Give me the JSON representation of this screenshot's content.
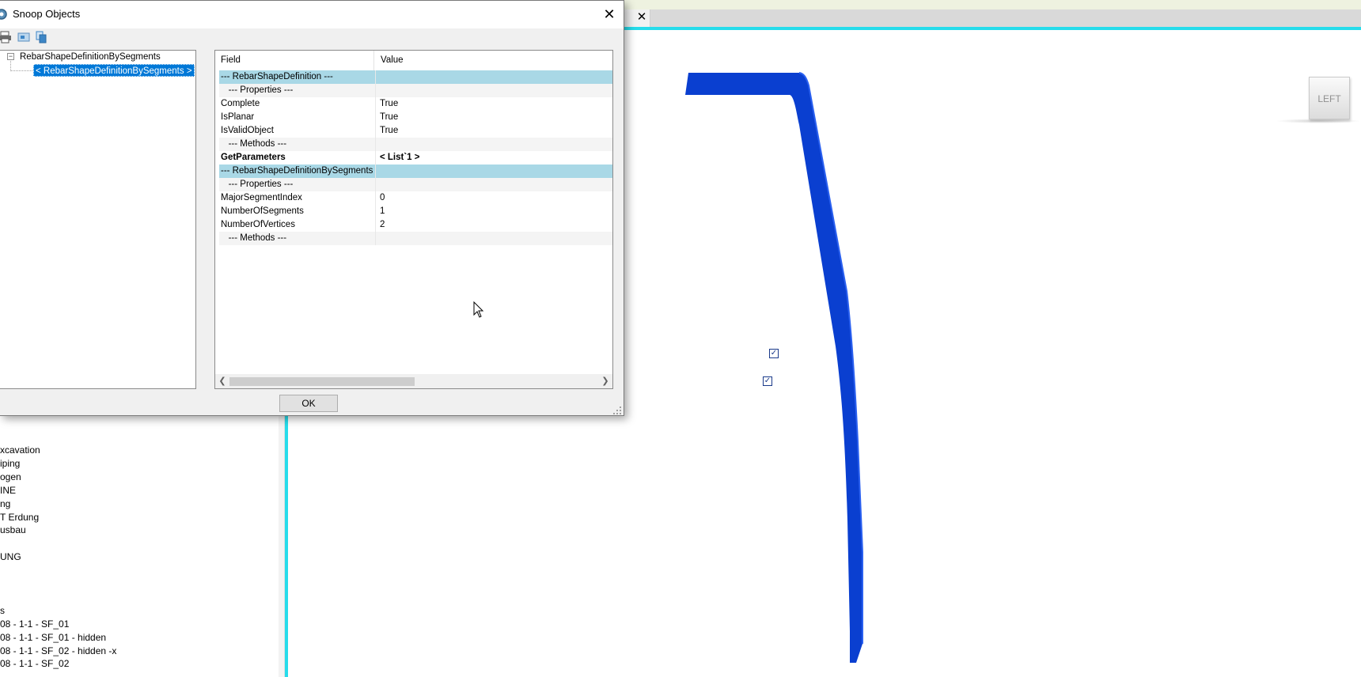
{
  "dialog": {
    "title": "Snoop Objects",
    "close_glyph": "✕",
    "ok_label": "OK",
    "toolbar": [
      {
        "icon": "print-icon"
      },
      {
        "icon": "snoop-screen-icon"
      },
      {
        "icon": "copy-icon"
      }
    ],
    "tree": {
      "root_expander": "−",
      "root_label": "RebarShapeDefinitionBySegments",
      "child_label": "< RebarShapeDefinitionBySegments >"
    },
    "grid": {
      "header_field": "Field",
      "header_value": "Value",
      "rows": [
        {
          "field": "--- RebarShapeDefinition ---",
          "value": "",
          "kind": "section"
        },
        {
          "field": "   --- Properties ---",
          "value": "",
          "kind": "sub"
        },
        {
          "field": "Complete",
          "value": "True",
          "kind": "normal"
        },
        {
          "field": "IsPlanar",
          "value": "True",
          "kind": "normal"
        },
        {
          "field": "IsValidObject",
          "value": "True",
          "kind": "normal"
        },
        {
          "field": "   --- Methods ---",
          "value": "",
          "kind": "sub"
        },
        {
          "field": "GetParameters",
          "value": "< List`1 >",
          "kind": "bold"
        },
        {
          "field": "--- RebarShapeDefinitionBySegments ---",
          "value": "",
          "kind": "section"
        },
        {
          "field": "   --- Properties ---",
          "value": "",
          "kind": "sub"
        },
        {
          "field": "MajorSegmentIndex",
          "value": "0",
          "kind": "normal"
        },
        {
          "field": "NumberOfSegments",
          "value": "1",
          "kind": "normal"
        },
        {
          "field": "NumberOfVertices",
          "value": "2",
          "kind": "normal"
        },
        {
          "field": "   --- Methods ---",
          "value": "",
          "kind": "sub"
        }
      ]
    }
  },
  "background": {
    "tab_close_glyph": "✕",
    "viewcube_label": "LEFT",
    "check_glyph": "✓",
    "layers": [
      "xcavation",
      "iping",
      "ogen",
      "INE",
      "ng",
      "T Erdung",
      "usbau",
      "",
      "UNG",
      "",
      "",
      "",
      "s",
      "08 - 1-1 - SF_01",
      "08 - 1-1 - SF_01 - hidden",
      "08 - 1-1 - SF_02 - hidden -x",
      "08 - 1-1 - SF_02"
    ]
  },
  "colors": {
    "rebar": "#0a3fd0",
    "section_bg": "#a9d8e6",
    "selection": "#0078d7",
    "cyan_border": "#26dceb"
  }
}
